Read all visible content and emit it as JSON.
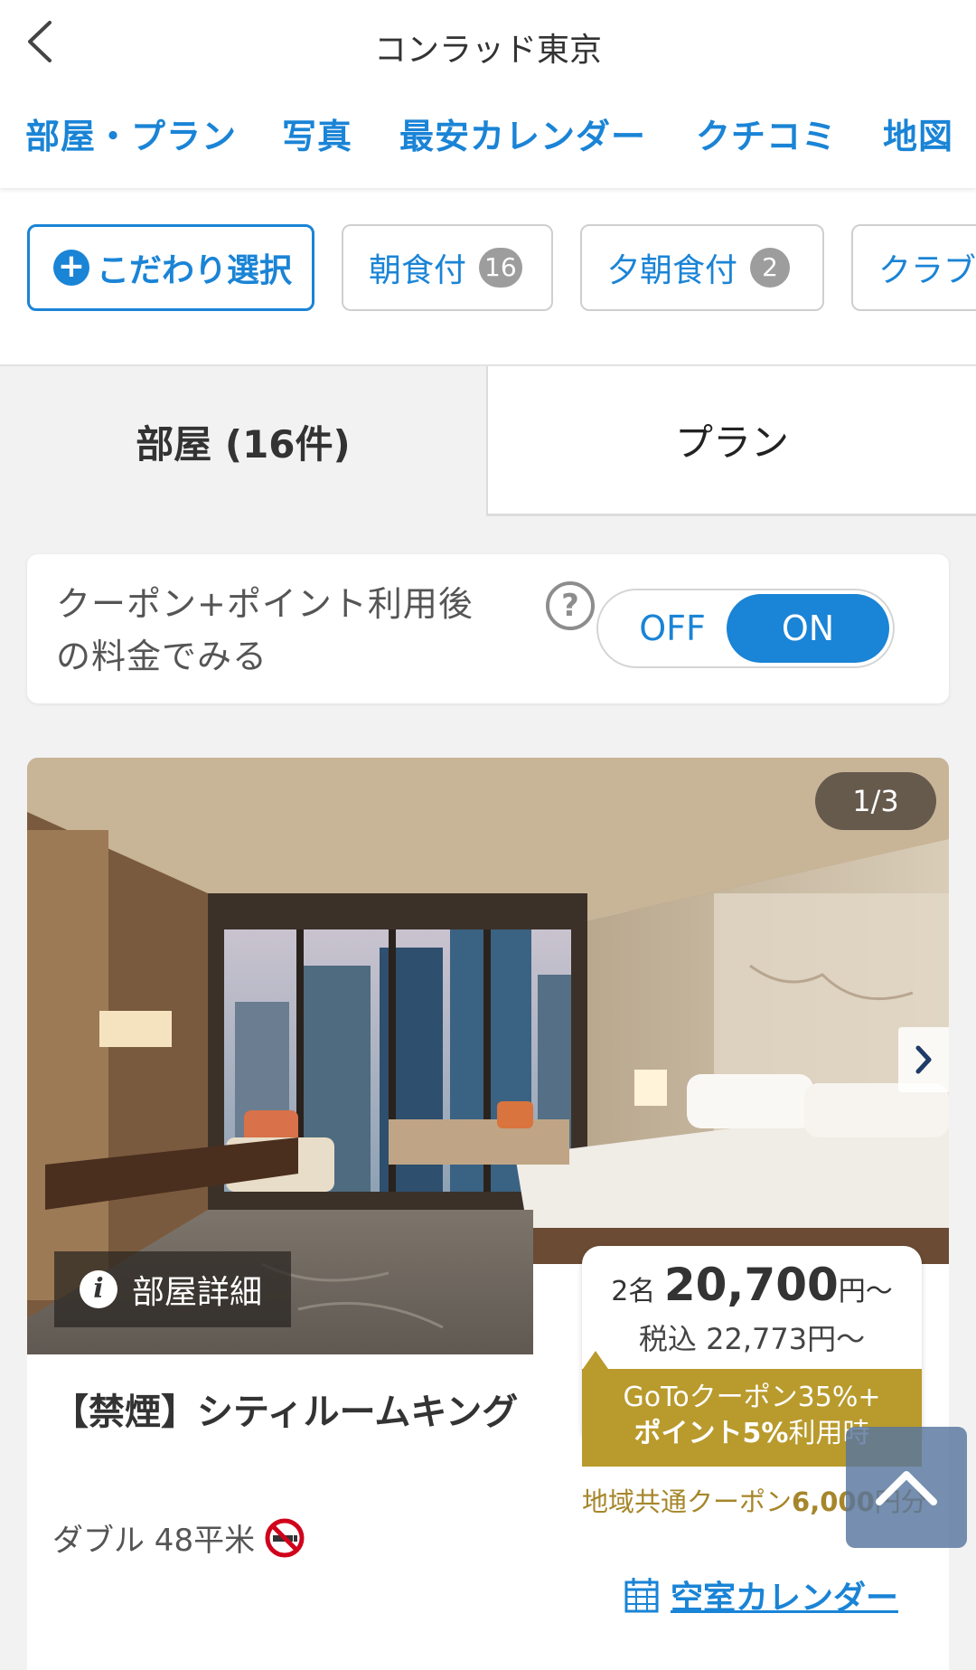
{
  "header": {
    "title": "コンラッド東京",
    "nav_tabs": [
      "部屋・プラン",
      "写真",
      "最安カレンダー",
      "クチコミ",
      "地図"
    ]
  },
  "filters": {
    "primary_label": "こだわり選択",
    "chips": [
      {
        "label": "朝食付",
        "count": "16"
      },
      {
        "label": "夕朝食付",
        "count": "2"
      },
      {
        "label": "クラブ"
      }
    ]
  },
  "view_tabs": {
    "room": "部屋 (16件)",
    "plan": "プラン"
  },
  "coupon_toggle": {
    "text": "クーポン+ポイント利用後の料金でみる",
    "help": "?",
    "off": "OFF",
    "on": "ON",
    "selected": "ON"
  },
  "room": {
    "photo_counter": "1/3",
    "detail_button": "部屋詳細",
    "name": "【禁煙】シティルームキング",
    "spec": "ダブル 48平米",
    "price": {
      "guests": "2名",
      "amount": "20,700",
      "unit": "円〜",
      "tax_included": "税込 22,773円〜"
    },
    "goto_badge": {
      "line1": "GoToクーポン35%+",
      "line2_bold": "ポイント5%",
      "line2_rest": "利用時"
    },
    "region_coupon": {
      "prefix": "地域共通クーポン",
      "amount": "6,000",
      "suffix": "円分"
    },
    "calendar_link": "空室カレンダー"
  },
  "colors": {
    "accent": "#1a84d6",
    "gold": "#b99a2c",
    "scroll_top_bg": "#58759e"
  },
  "icons": [
    "back-chevron-icon",
    "plus-circle-icon",
    "help-icon",
    "info-icon",
    "no-smoking-icon",
    "calendar-icon",
    "chevron-right-icon",
    "chevron-up-icon"
  ]
}
